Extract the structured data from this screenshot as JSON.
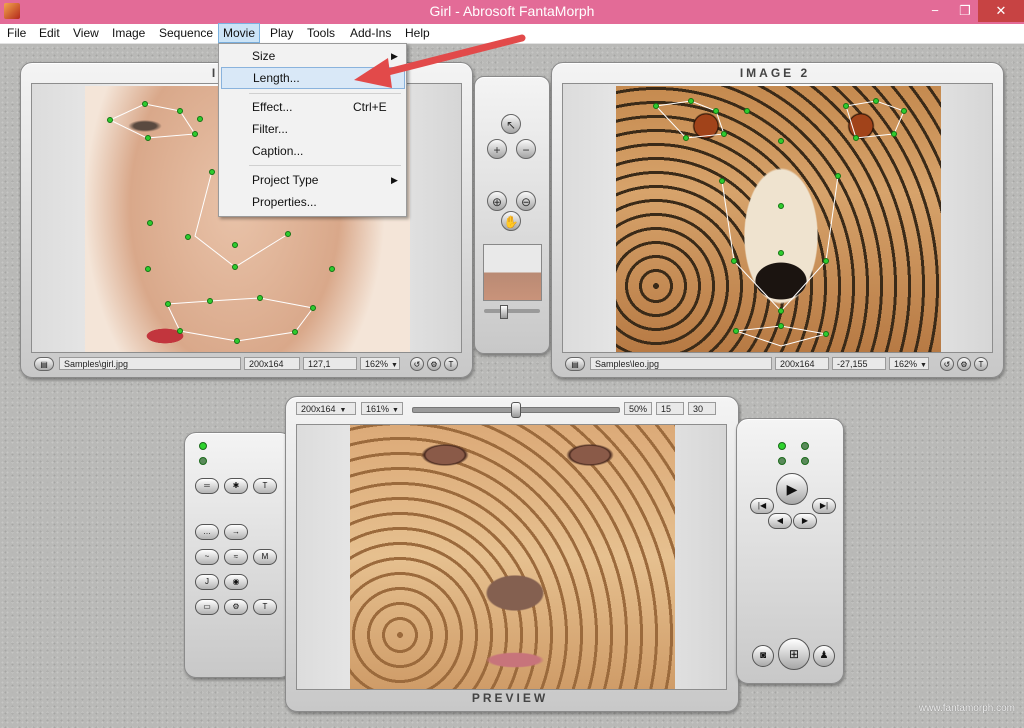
{
  "window": {
    "title": "Girl - Abrosoft FantaMorph",
    "min_glyph": "−",
    "max_glyph": "❐",
    "close_glyph": "✕"
  },
  "menu": {
    "items": [
      "File",
      "Edit",
      "View",
      "Image",
      "Sequence",
      "Movie",
      "Play",
      "Tools",
      "Add-Ins",
      "Help"
    ],
    "active": "Movie"
  },
  "movie_menu": {
    "size": "Size",
    "length": "Length...",
    "effect": "Effect...",
    "effect_shortcut": "Ctrl+E",
    "filter": "Filter...",
    "caption": "Caption...",
    "project_type": "Project Type",
    "properties": "Properties...",
    "submenu_arrow": "▶"
  },
  "image1": {
    "title": "I",
    "path": "Samples\\girl.jpg",
    "dimensions": "200x164",
    "coords": "127,1",
    "zoom": "162%"
  },
  "image2": {
    "title": "IMAGE 2",
    "path": "Samples\\leo.jpg",
    "dimensions": "200x164",
    "coords": "-27,155",
    "zoom": "162%"
  },
  "preview": {
    "title": "PREVIEW",
    "dimensions": "200x164",
    "zoom": "161%",
    "progress_text": "50%",
    "progress": 0.5,
    "frame": "15",
    "fps": "30"
  },
  "dropdown_caret": "▼",
  "watermark": "www.fantamorph.com",
  "colors": {
    "titlebar": "#e36b97",
    "menu_highlight": "#cce4f7",
    "arrow": "#e24a4a",
    "key_point": "#2ecc2e"
  }
}
